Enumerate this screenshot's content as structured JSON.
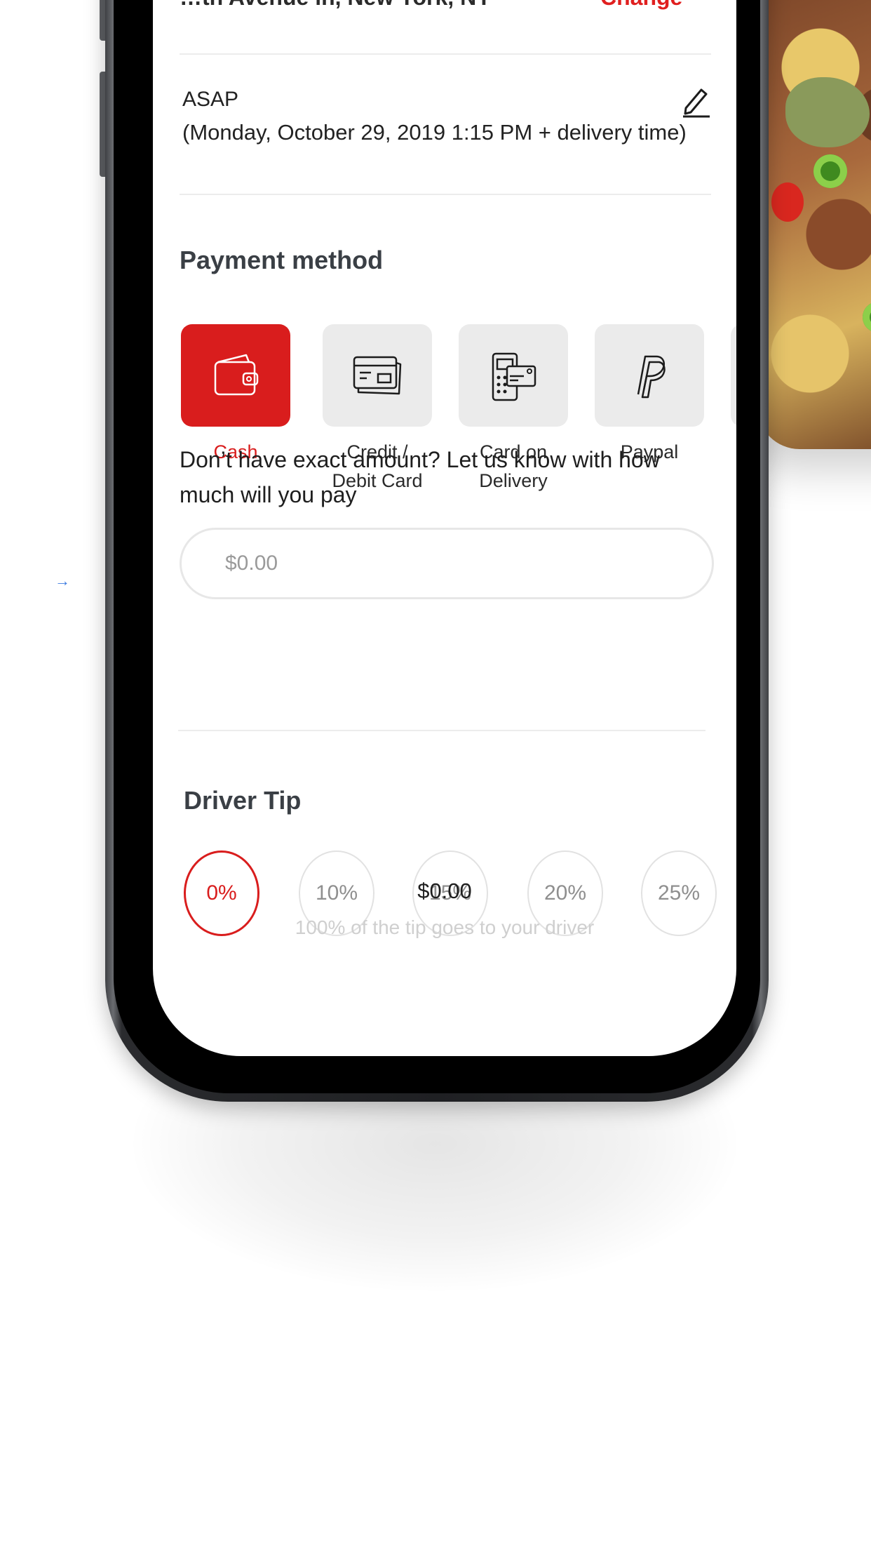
{
  "delivery": {
    "address": "…th Avenue ln, New York, NY",
    "change_label": "Change",
    "schedule_label": "ASAP",
    "schedule_detail": "(Monday, October 29, 2019 1:15 PM + delivery time)"
  },
  "payment": {
    "title": "Payment method",
    "options": [
      {
        "label": "Cash",
        "icon": "wallet-icon",
        "selected": true
      },
      {
        "label": "Credit / Debit Card",
        "icon": "credit-card-icon",
        "selected": false
      },
      {
        "label": "Card on Delivery",
        "icon": "card-terminal-icon",
        "selected": false
      },
      {
        "label": "Paypal",
        "icon": "paypal-icon",
        "selected": false
      }
    ],
    "cash_hint": "Don’t have exact amount? Let us know with how much will you pay",
    "amount_placeholder": "$0.00"
  },
  "tip": {
    "title": "Driver Tip",
    "options": [
      "0%",
      "10%",
      "15%",
      "20%",
      "25%"
    ],
    "selected": "0%",
    "amount": "$0.00",
    "note": "100% of the tip goes to your driver"
  },
  "colors": {
    "accent": "#d91d1d",
    "tile_bg": "#ebebeb",
    "muted_text": "#8f8f8f"
  }
}
